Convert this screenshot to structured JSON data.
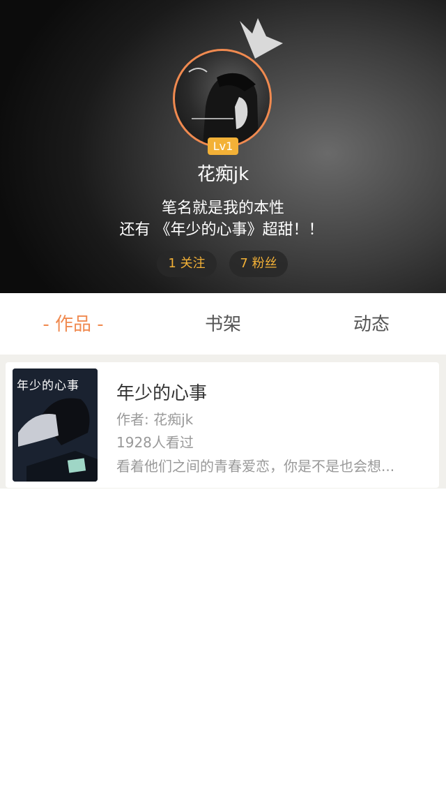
{
  "profile": {
    "username": "花痴jk",
    "level": "Lv1",
    "bio_line1": "笔名就是我的本性",
    "bio_line2": "还有 《年少的心事》超甜！！",
    "following": "1 关注",
    "followers": "7 粉丝"
  },
  "tabs": [
    {
      "label": "- 作品 -",
      "active": true
    },
    {
      "label": "书架",
      "active": false
    },
    {
      "label": "动态",
      "active": false
    }
  ],
  "books": [
    {
      "title": "年少的心事",
      "author": "作者: 花痴jk",
      "views": "1928人看过",
      "description": "看着他们之间的青春爱恋，你是不是也会想...",
      "cover_title": "年少的心事"
    }
  ],
  "colors": {
    "accent": "#f08a50",
    "badge": "#f3b137"
  }
}
